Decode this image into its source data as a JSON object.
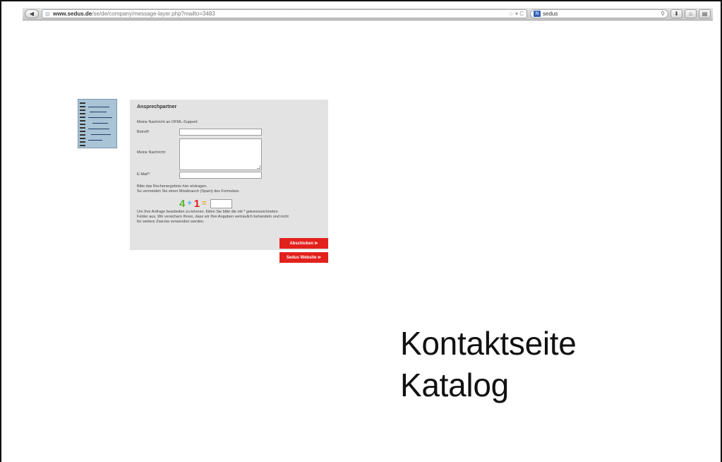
{
  "browser": {
    "url": "www.sedus.de/se/de/company/message-layer.php?mailto=3483",
    "url_domain": "www.sedus.de",
    "url_path": "/se/de/company/message-layer.php?mailto=3483",
    "url_right": "☆ ▾ C",
    "search_text": "sedus",
    "back_glyph": "◀",
    "forward_glyph": "▶",
    "icons": [
      "globe-icon",
      "star-icon",
      "reload-icon",
      "search-icon",
      "download-icon",
      "home-icon",
      "menu-icon"
    ]
  },
  "form": {
    "title": "Ansprechpartner",
    "intro": "Meine Nachricht an OFML-Support:",
    "subject_label": "Betreff:",
    "message_label": "Meine Nachricht:",
    "email_label": "E-Mail*:",
    "captcha_hint_line1": "Bitte das Rechenergebnis hier eintragen.",
    "captcha_hint_line2": "So vermeiden Sie einen Missbrauch (Spam) des Formulars.",
    "captcha": {
      "a": "4",
      "op": "+",
      "b": "1",
      "eq": "="
    },
    "notice_line1": "Um Ihre Anfrage bearbeiten zu können, füllen Sie bitte die mit * gekennzeichneten",
    "notice_line2": "Felder aus. Wir versichern Ihnen, dass wir Ihre Angaben vertraulich behandeln und nicht",
    "notice_line3": "für weitere Zwecke verwenden werden.",
    "submit_label": "Abschicken ⊳",
    "website_label": "Sedus Website ⊳"
  },
  "caption": {
    "line1": "Kontaktseite",
    "line2": "Katalog"
  },
  "colors": {
    "button_red": "#e2201c",
    "captcha_green": "#5cb531",
    "captcha_red": "#e2201c",
    "captcha_op": "#3bb8e8",
    "captcha_eq": "#f0a020",
    "panel_bg": "#e3e3e3"
  }
}
